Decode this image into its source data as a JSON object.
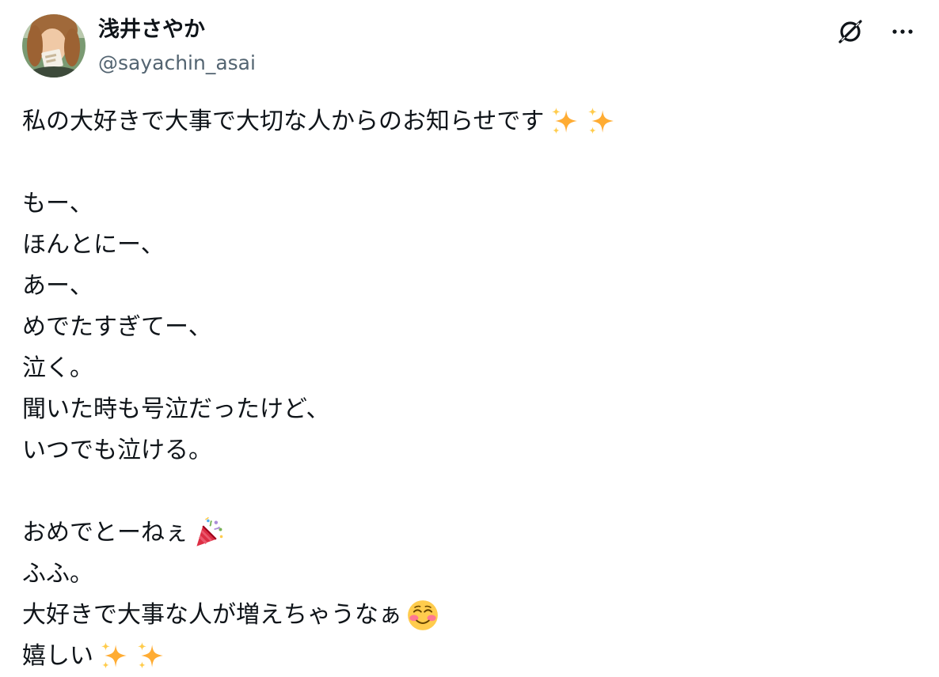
{
  "author": {
    "name": "浅井さやか",
    "handle": "@sayachin_asai"
  },
  "header_icons": [
    "grok-icon",
    "more-icon"
  ],
  "tweet": {
    "line1": "私の大好きで大事で大切な人からのお知らせです",
    "line2": "もー、",
    "line3": "ほんとにー、",
    "line4": "あー、",
    "line5": "めでたすぎてー、",
    "line6": "泣く。",
    "line7": "聞いた時も号泣だったけど、",
    "line8": "いつでも泣ける。",
    "line9": "おめでとーねぇ",
    "line10": "ふふ。",
    "line11": "大好きで大事な人が増えちゃうなぁ",
    "line12": "嬉しい"
  },
  "emoji": {
    "sparkles": "sparkles-emoji",
    "party_popper": "party-popper-emoji",
    "smiling_face": "smiling-face-emoji"
  },
  "colors": {
    "text": "#0f1419",
    "secondary": "#536471",
    "sparkle": "#ffac33",
    "blush": "#ffcc4d"
  }
}
